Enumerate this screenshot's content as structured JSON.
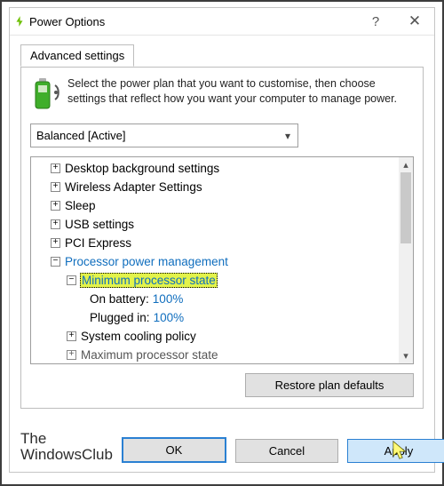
{
  "window": {
    "title": "Power Options"
  },
  "tab": {
    "label": "Advanced settings"
  },
  "description": "Select the power plan that you want to customise, then choose settings that reflect how you want your computer to manage power.",
  "plan_selector": {
    "value": "Balanced [Active]"
  },
  "tree": {
    "n0": "Desktop background settings",
    "n1": "Wireless Adapter Settings",
    "n2": "Sleep",
    "n3": "USB settings",
    "n4": "PCI Express",
    "n5": "Processor power management",
    "n5a": "Minimum processor state",
    "n5a_batt_label": "On battery:",
    "n5a_batt_val": "100%",
    "n5a_plug_label": "Plugged in:",
    "n5a_plug_val": "100%",
    "n5b": "System cooling policy",
    "n5c": "Maximum processor state"
  },
  "buttons": {
    "restore": "Restore plan defaults",
    "ok": "OK",
    "cancel": "Cancel",
    "apply": "Apply"
  },
  "brand": {
    "line1": "The",
    "line2": "WindowsClub"
  }
}
